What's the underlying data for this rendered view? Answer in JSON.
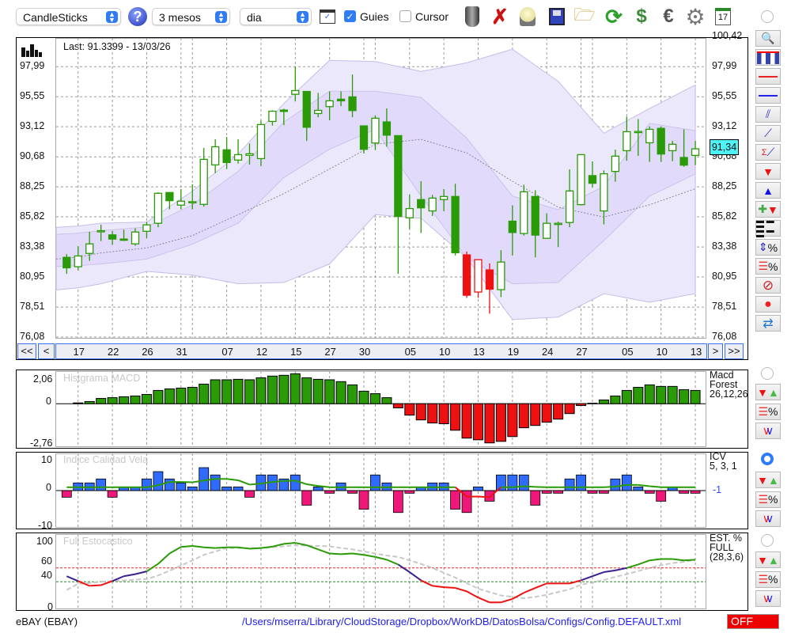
{
  "toolbar": {
    "chart_type": "CandleSticks",
    "period": "3 mesos",
    "interval": "dia",
    "guides_label": "Guies",
    "guides_checked": true,
    "cursor_label": "Cursor",
    "cursor_checked": false,
    "icons": [
      "help-icon",
      "chart-window-icon",
      "trash-icon",
      "delete-icon",
      "lamp-icon",
      "save-icon",
      "folder-icon",
      "refresh-icon",
      "refresh-currency-icon",
      "euro-icon",
      "gear-icon",
      "calendar-icon"
    ],
    "calendar_day": "17"
  },
  "main": {
    "last_label": "Last: 91.3399 - 13/03/26",
    "price_badge": "91,34",
    "y_ticks": [
      "76,08",
      "78,51",
      "80,95",
      "83,38",
      "85,82",
      "88,25",
      "90,68",
      "93,12",
      "95,55",
      "97,99",
      "100,42"
    ],
    "x_labels": [
      {
        "label": "17",
        "index": 2
      },
      {
        "label": "22",
        "index": 5
      },
      {
        "label": "26",
        "index": 8
      },
      {
        "label": "31",
        "index": 11
      },
      {
        "label": "07",
        "index": 15
      },
      {
        "label": "12",
        "index": 18
      },
      {
        "label": "15",
        "index": 21
      },
      {
        "label": "27",
        "index": 24
      },
      {
        "label": "30",
        "index": 27
      },
      {
        "label": "05",
        "index": 31
      },
      {
        "label": "10",
        "index": 34
      },
      {
        "label": "13",
        "index": 37
      },
      {
        "label": "19",
        "index": 40
      },
      {
        "label": "24",
        "index": 43
      },
      {
        "label": "27",
        "index": 46
      },
      {
        "label": "05",
        "index": 50
      },
      {
        "label": "10",
        "index": 53
      },
      {
        "label": "13",
        "index": 56
      }
    ],
    "nav": {
      "first": "<<",
      "prev": "<",
      "next": ">",
      "last": ">>"
    }
  },
  "panels": {
    "macd": {
      "title": "Histgrama MACD",
      "legend": [
        "Macd",
        "Forest",
        "26,12,26"
      ],
      "y_ticks": [
        "2,06",
        "0",
        "-2,76"
      ]
    },
    "icv": {
      "title": "Indice Calidad Vela",
      "legend": [
        "ICV",
        "5, 3, 1"
      ],
      "value": "-1",
      "y_ticks": [
        "10",
        "0",
        "-10"
      ]
    },
    "stoch": {
      "title": "Full Estocastico",
      "legend": [
        "EST. %",
        "FULL",
        "(28,3,6)"
      ],
      "y_ticks": [
        "100",
        "60",
        "40",
        "0"
      ]
    }
  },
  "right_toolbar": [
    "zoom-icon",
    "volume-chart-icon",
    "red-line-icon",
    "blue-line-icon",
    "channel-icon",
    "trendline-icon",
    "sigma-trendline-icon",
    "sell-arrow-icon",
    "buy-arrow-icon",
    "add-signal-icon",
    "dashed-lines-icon",
    "percent-range-icon",
    "percent-lines-icon",
    "stop-icon",
    "record-icon",
    "sync-icon"
  ],
  "footer": {
    "symbol": "eBAY (EBAY)",
    "config_path": "/Users/mserra/Library/CloudStorage/Dropbox/WorkDB/DatosBolsa/Configs/Config.DEFAULT.xml",
    "status": "OFF"
  },
  "colors": {
    "up": "#2a9a07",
    "red": "#ee1111",
    "blue": "#2f6bff",
    "pink": "#f0177a",
    "band_outer": "#ece8fc",
    "band_inner": "#e0d8fa",
    "stoch_high": "#2a9a07",
    "stoch_mid": "#3a1f8f",
    "stoch_low": "#ee1111"
  },
  "chart_data": [
    {
      "type": "candlestick",
      "ylim": [
        76.08,
        100.42
      ],
      "ohlc": [
        [
          82.54,
          82.8,
          81.2,
          81.69
        ],
        [
          81.78,
          83.44,
          81.48,
          82.65
        ],
        [
          82.86,
          84.61,
          82.26,
          83.63
        ],
        [
          84.65,
          85.19,
          83.86,
          84.7
        ],
        [
          84.36,
          84.68,
          83.55,
          84.02
        ],
        [
          84.02,
          84.78,
          83.86,
          84.0
        ],
        [
          83.63,
          84.89,
          83.48,
          84.59
        ],
        [
          84.65,
          85.4,
          84.08,
          85.17
        ],
        [
          85.3,
          87.81,
          84.98,
          87.73
        ],
        [
          87.79,
          87.79,
          86.43,
          87.13
        ],
        [
          86.77,
          88.07,
          86.43,
          87.09
        ],
        [
          87.02,
          88.45,
          86.43,
          87.05
        ],
        [
          86.83,
          91.4,
          86.64,
          90.48
        ],
        [
          90.03,
          92.1,
          89.37,
          91.5
        ],
        [
          91.25,
          92.29,
          89.69,
          90.22
        ],
        [
          90.42,
          92.1,
          90.14,
          90.86
        ],
        [
          90.8,
          91.76,
          90.05,
          90.93
        ],
        [
          90.54,
          93.62,
          89.93,
          93.3
        ],
        [
          93.55,
          94.45,
          93.21,
          94.38
        ],
        [
          94.47,
          94.58,
          93.25,
          94.36
        ],
        [
          95.75,
          97.99,
          95.17,
          96.05
        ],
        [
          95.98,
          95.98,
          91.97,
          93.08
        ],
        [
          94.19,
          95.86,
          93.89,
          94.45
        ],
        [
          94.75,
          95.98,
          93.64,
          95.22
        ],
        [
          95.35,
          95.98,
          94.79,
          95.22
        ],
        [
          95.54,
          97.35,
          93.89,
          94.43
        ],
        [
          93.19,
          93.19,
          90.95,
          91.29
        ],
        [
          91.8,
          94.04,
          91.23,
          93.81
        ],
        [
          93.51,
          94.6,
          91.5,
          92.44
        ],
        [
          92.4,
          92.4,
          81.2,
          85.85
        ],
        [
          85.74,
          87.64,
          84.83,
          86.49
        ],
        [
          87.22,
          88.71,
          84.51,
          86.55
        ],
        [
          86.3,
          87.6,
          85.89,
          87.34
        ],
        [
          87.22,
          88.07,
          86.28,
          87.47
        ],
        [
          87.47,
          88.5,
          82.69,
          82.91
        ],
        [
          82.74,
          83.01,
          79.26,
          79.47
        ],
        [
          79.73,
          82.35,
          79.26,
          82.35
        ],
        [
          81.52,
          82.05,
          77.98,
          79.96
        ],
        [
          79.92,
          83.12,
          79.32,
          82.16
        ],
        [
          85.47,
          86.75,
          82.69,
          84.55
        ],
        [
          84.47,
          88.42,
          84.3,
          87.85
        ],
        [
          87.47,
          87.98,
          82.54,
          84.34
        ],
        [
          84.08,
          86.11,
          84.08,
          85.3
        ],
        [
          85.3,
          85.43,
          83.37,
          85.3
        ],
        [
          85.36,
          89.67,
          84.98,
          87.92
        ],
        [
          86.81,
          90.86,
          86.75,
          90.86
        ],
        [
          89.16,
          90.31,
          88.18,
          88.54
        ],
        [
          86.3,
          89.58,
          85.21,
          89.31
        ],
        [
          89.5,
          91.27,
          88.67,
          90.74
        ],
        [
          91.18,
          93.94,
          90.37,
          92.72
        ],
        [
          92.74,
          93.74,
          90.76,
          92.74
        ],
        [
          91.82,
          93.15,
          90.27,
          92.91
        ],
        [
          92.99,
          93.15,
          90.27,
          90.91
        ],
        [
          91.18,
          91.97,
          90.33,
          91.7
        ],
        [
          90.63,
          92.91,
          89.88,
          90.01
        ],
        [
          90.8,
          91.97,
          90.01,
          91.33
        ]
      ],
      "red_candles": [
        36,
        37,
        38
      ],
      "bands": {
        "at_candle": [
          1,
          4,
          8,
          12,
          16,
          20,
          24,
          28,
          32,
          36,
          40,
          44,
          48,
          52,
          56
        ],
        "outer_upper": [
          84.97,
          85.3,
          85.4,
          87.9,
          90.9,
          95.0,
          98.5,
          98.4,
          97.6,
          98.3,
          99.4,
          96.8,
          92.6,
          94.6,
          96.5
        ],
        "inner_upper": [
          84.4,
          84.7,
          85.0,
          86.8,
          89.5,
          93.5,
          96.0,
          96.0,
          95.5,
          92.2,
          87.5,
          86.4,
          88.3,
          93.4,
          92.8
        ],
        "middle": [
          82.4,
          82.9,
          83.3,
          84.3,
          86.0,
          87.7,
          89.7,
          91.7,
          92.1,
          91.0,
          88.7,
          86.6,
          85.8,
          86.8,
          88.1
        ],
        "inner_lower": [
          81.8,
          82.0,
          82.4,
          83.6,
          85.3,
          89.0,
          91.3,
          92.9,
          87.5,
          82.5,
          80.4,
          80.5,
          83.9,
          87.5,
          89.3
        ],
        "outer_lower": [
          79.9,
          80.4,
          81.4,
          81.1,
          80.4,
          80.5,
          82.0,
          86.0,
          85.7,
          82.5,
          77.5,
          77.7,
          79.6,
          78.9,
          79.6
        ]
      }
    },
    {
      "type": "bar",
      "name": "Histgrama MACD",
      "ylim": [
        -2.76,
        2.06
      ],
      "values": [
        0,
        0.05,
        0.14,
        0.34,
        0.39,
        0.45,
        0.5,
        0.6,
        0.86,
        0.96,
        1.01,
        1.06,
        1.27,
        1.55,
        1.55,
        1.58,
        1.55,
        1.68,
        1.79,
        1.84,
        1.94,
        1.68,
        1.58,
        1.55,
        1.43,
        1.22,
        0.81,
        0.65,
        0.39,
        -0.27,
        -0.74,
        -1.05,
        -1.25,
        -1.3,
        -1.72,
        -2.23,
        -2.34,
        -2.54,
        -2.44,
        -2.13,
        -1.56,
        -1.41,
        -1.2,
        -1.0,
        -0.64,
        -0.12,
        0.03,
        0.24,
        0.5,
        0.86,
        1.06,
        1.22,
        1.12,
        1.12,
        0.91,
        0.86
      ]
    },
    {
      "type": "bar",
      "name": "Indice Calidad Vela",
      "ylim": [
        -10,
        10
      ],
      "values": [
        -2,
        2.3,
        2.3,
        3.5,
        -2,
        1,
        1,
        3.5,
        5.7,
        3.5,
        2.3,
        1.1,
        6.9,
        4.7,
        1.1,
        1.1,
        -2,
        4.7,
        4.7,
        3.5,
        4.7,
        -4.4,
        1.1,
        -0.8,
        2.3,
        -0.8,
        -5.6,
        4.7,
        2.3,
        -6.6,
        -0.8,
        1.1,
        2.3,
        2.3,
        -5.6,
        -6.6,
        1.1,
        -3.2,
        4.7,
        4.7,
        4.7,
        -4.4,
        -0.8,
        -0.8,
        3.5,
        4.7,
        -0.8,
        -0.8,
        3.5,
        4.7,
        1.1,
        -0.8,
        -3.2,
        1.1,
        -0.8,
        -0.8
      ],
      "line": [
        1,
        1,
        1,
        1,
        1,
        1,
        1,
        1,
        1.6,
        2.6,
        2.6,
        2.5,
        3,
        3.5,
        3.5,
        3.1,
        1.8,
        2.1,
        2.6,
        2.9,
        3,
        1.9,
        1.4,
        1,
        1,
        1,
        1,
        1,
        1,
        1,
        1,
        1,
        1,
        1,
        1,
        -1.8,
        -1.8,
        -2,
        1,
        1,
        1.3,
        1.1,
        1,
        1,
        1,
        1,
        1,
        1,
        1.2,
        1.7,
        1.7,
        1.3,
        1,
        1,
        1,
        1
      ]
    },
    {
      "type": "line",
      "name": "Full Estocastico",
      "ylim": [
        0,
        100
      ],
      "levels": [
        60,
        40
      ],
      "k": [
        48,
        41,
        34,
        35,
        41,
        48,
        51,
        55,
        66,
        81,
        90.5,
        92,
        90,
        89,
        90,
        90,
        88,
        89,
        91,
        95,
        96.5,
        93,
        87,
        81,
        80,
        81,
        79,
        76,
        72,
        65,
        54,
        42,
        34,
        32,
        31,
        26,
        17,
        10,
        10,
        15,
        24,
        31,
        37.5,
        37.5,
        37.5,
        42,
        48,
        54,
        56.5,
        60,
        65,
        71,
        73,
        73,
        71,
        72
      ],
      "d": [
        28,
        37,
        38,
        40,
        41,
        42,
        43,
        44,
        49,
        56,
        63.5,
        71,
        79,
        84,
        89,
        89,
        89,
        89,
        90,
        91.5,
        93,
        92.5,
        92,
        91.5,
        89,
        87,
        84,
        81,
        78,
        76,
        71,
        66,
        60,
        53,
        46,
        38,
        30,
        25,
        20,
        18,
        16,
        18,
        21,
        25,
        29,
        35.5,
        39,
        42.5,
        47,
        51,
        55.5,
        60,
        64,
        67,
        69,
        71.6
      ]
    }
  ]
}
